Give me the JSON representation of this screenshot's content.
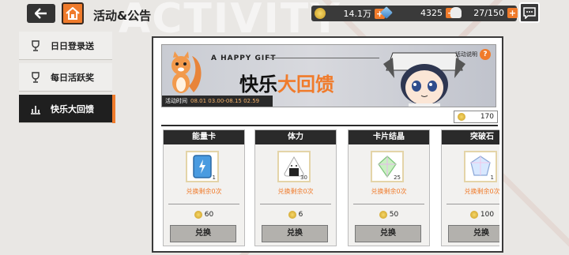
{
  "header": {
    "bg_word": "ACTIVITY",
    "title": "活动&公告",
    "resources": [
      {
        "icon": "gold-coin-icon",
        "value": "14.1万",
        "color": "#e8c15a"
      },
      {
        "icon": "diamond-icon",
        "value": "4325",
        "color": "#6fa8dc"
      },
      {
        "icon": "stamina-icon",
        "value": "27/150",
        "color": "#cccccc"
      }
    ]
  },
  "sidebar": {
    "items": [
      {
        "label": "日日登录送",
        "active": false
      },
      {
        "label": "每日活跃奖",
        "active": false
      },
      {
        "label": "快乐大回馈",
        "active": true
      }
    ]
  },
  "banner": {
    "tagline": "A HAPPY GIFT",
    "title_black": "快乐",
    "title_orange": "大回馈",
    "time_label": "活动时间",
    "time_range": "08.01 03.00-08.15 02.59",
    "help_label": "活动说明"
  },
  "balance": {
    "value": "170"
  },
  "cards": [
    {
      "name": "能量卡",
      "count": "1",
      "remaining": "兑换剩余0次",
      "price": "60",
      "button": "兑换",
      "icon": "energy-card-icon"
    },
    {
      "name": "体力",
      "count": "30",
      "remaining": "兑换剩余0次",
      "price": "6",
      "button": "兑换",
      "icon": "rice-ball-icon"
    },
    {
      "name": "卡片结晶",
      "count": "25",
      "remaining": "兑换剩余0次",
      "price": "50",
      "button": "兑换",
      "icon": "card-crystal-icon"
    },
    {
      "name": "突破石",
      "count": "1",
      "remaining": "兑换剩余0次",
      "price": "100",
      "button": "兑换",
      "icon": "breakthrough-stone-icon"
    }
  ],
  "colors": {
    "accent": "#f07b2b",
    "dark": "#2a2a2a"
  }
}
